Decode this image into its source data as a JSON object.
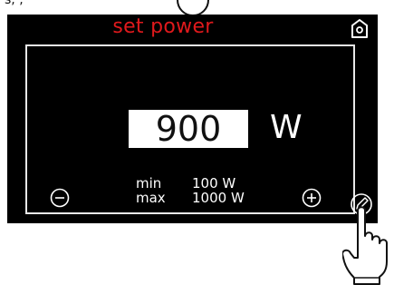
{
  "top_label": "s, ,",
  "screen": {
    "title": "set power",
    "value": "900",
    "unit": "W",
    "min_label": "min",
    "min_value": "100 W",
    "max_label": "max",
    "max_value": "1000 W"
  },
  "icons": {
    "home": "home-icon",
    "decrease": "minus-circle-icon",
    "increase": "plus-circle-icon",
    "edit": "pencil-circle-icon",
    "pointer": "pointing-hand-icon"
  },
  "colors": {
    "screen_background": "#000000",
    "title": "#e0191c",
    "text": "#ffffff",
    "value_box": "#ffffff",
    "value_text": "#111111"
  }
}
